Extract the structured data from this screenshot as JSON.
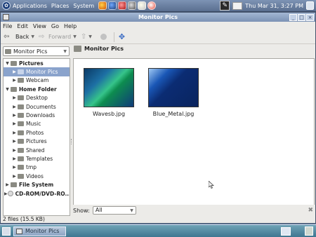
{
  "panel": {
    "menus": [
      "Applications",
      "Places",
      "System"
    ],
    "launchers": [
      "firefox-launcher-icon",
      "evolution-launcher-icon",
      "terminal-launcher-icon",
      "media-launcher-icon",
      "notes-launcher-icon",
      "help-launcher-icon"
    ],
    "clock": "Thu Mar 31,  3:27 PM"
  },
  "window": {
    "title": "Monitor Pics",
    "menubar": [
      "File",
      "Edit",
      "View",
      "Go",
      "Help"
    ],
    "toolbar": {
      "back_label": "Back",
      "forward_label": "Forward"
    },
    "side_pane_select": "Monitor Pics",
    "location_label": "Monitor Pics",
    "tree": [
      {
        "label": "Pictures",
        "depth": 0,
        "expanded": true,
        "bold": true
      },
      {
        "label": "Monitor Pics",
        "depth": 1,
        "expanded": false,
        "selected": true
      },
      {
        "label": "Webcam",
        "depth": 1,
        "expanded": false
      },
      {
        "label": "Home Folder",
        "depth": 0,
        "expanded": true,
        "bold": true
      },
      {
        "label": "Desktop",
        "depth": 1
      },
      {
        "label": "Documents",
        "depth": 1
      },
      {
        "label": "Downloads",
        "depth": 1
      },
      {
        "label": "Music",
        "depth": 1
      },
      {
        "label": "Photos",
        "depth": 1
      },
      {
        "label": "Pictures",
        "depth": 1
      },
      {
        "label": "Shared",
        "depth": 1
      },
      {
        "label": "Templates",
        "depth": 1
      },
      {
        "label": "tmp",
        "depth": 1
      },
      {
        "label": "Videos",
        "depth": 1
      },
      {
        "label": "File System",
        "depth": 0,
        "bold": true
      },
      {
        "label": "CD-ROM/DVD-RO...",
        "depth": 0,
        "bold": true,
        "disc": true
      }
    ],
    "files": [
      {
        "name": "Wavesb.jpg"
      },
      {
        "name": "Blue_Metal.jpg"
      }
    ],
    "filter": {
      "label": "Show:",
      "value": "All"
    },
    "status": "2 files (15.5 KB)"
  },
  "taskbar": {
    "task_label": "Monitor Pics"
  }
}
